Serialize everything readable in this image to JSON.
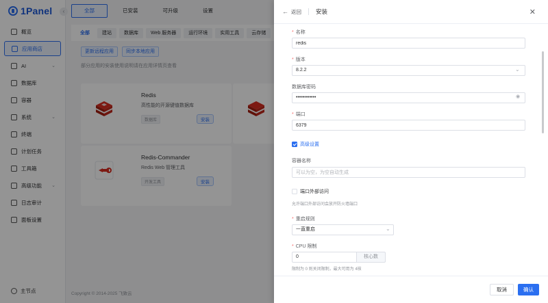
{
  "app": {
    "logo": "1Panel",
    "node": "主节点"
  },
  "sidebar": {
    "items": [
      {
        "label": "概览",
        "icon": "overview-icon",
        "active": false
      },
      {
        "label": "应用商店",
        "icon": "app-store-icon",
        "active": true
      },
      {
        "label": "AI",
        "icon": "robot-icon",
        "chevron": true
      },
      {
        "label": "数据库",
        "icon": "database-icon"
      },
      {
        "label": "容器",
        "icon": "container-icon"
      },
      {
        "label": "系统",
        "icon": "system-icon",
        "chevron": true
      },
      {
        "label": "终端",
        "icon": "terminal-icon"
      },
      {
        "label": "计划任务",
        "icon": "cron-icon"
      },
      {
        "label": "工具箱",
        "icon": "toolbox-icon"
      },
      {
        "label": "高级功能",
        "icon": "diamond-icon",
        "chevron": true
      },
      {
        "label": "日志审计",
        "icon": "log-icon"
      },
      {
        "label": "面板设置",
        "icon": "settings-icon"
      }
    ]
  },
  "topbar": {
    "tabs": [
      "全部",
      "已安装",
      "可升级",
      "设置"
    ]
  },
  "categories": [
    "全部",
    "建站",
    "数据库",
    "Web 服务器",
    "运行环境",
    "实用工具",
    "云存储"
  ],
  "actions": {
    "sync_remote": "更新远程应用",
    "sync_local": "同步本地应用"
  },
  "notice": "部分应用的安装使用说明请在应用详情页查看",
  "cards": [
    {
      "name": "Redis",
      "desc": "高性能的开源键值数据库",
      "tag": "数据库",
      "install": "安装"
    },
    {
      "name": "Redis-Commander",
      "desc": "Redis Web 管理工具",
      "tag": "开发工具",
      "install": "安装"
    }
  ],
  "footer": "Copyright © 2014-2025 飞致云",
  "drawer": {
    "back": "返回",
    "title": "安装",
    "fields": {
      "name": {
        "label": "名称",
        "value": "redis"
      },
      "version": {
        "label": "版本",
        "value": "8.2.2"
      },
      "password": {
        "label": "数据库密码",
        "value": "••••••••••••"
      },
      "port": {
        "label": "端口",
        "value": "6379"
      },
      "advanced": {
        "label": "高级设置",
        "checked": true
      },
      "container_name": {
        "label": "容器名称",
        "placeholder": "可以为空，为空自动生成"
      },
      "external_access": {
        "label": "端口外部访问",
        "checked": false,
        "hint": "允许端口外部访问会放开防火墙端口"
      },
      "restart_policy": {
        "label": "重启规则",
        "value": "一直重启"
      },
      "cpu_limit": {
        "label": "CPU 限制",
        "value": "0",
        "unit": "核心数",
        "hint": "限制为 0 则关闭限制，最大可用为 4核"
      }
    },
    "buttons": {
      "cancel": "取消",
      "confirm": "确认"
    }
  },
  "colors": {
    "primary": "#2b6ff0",
    "overlay": "rgba(0,0,0,0.42)",
    "danger": "#f56c6c"
  }
}
